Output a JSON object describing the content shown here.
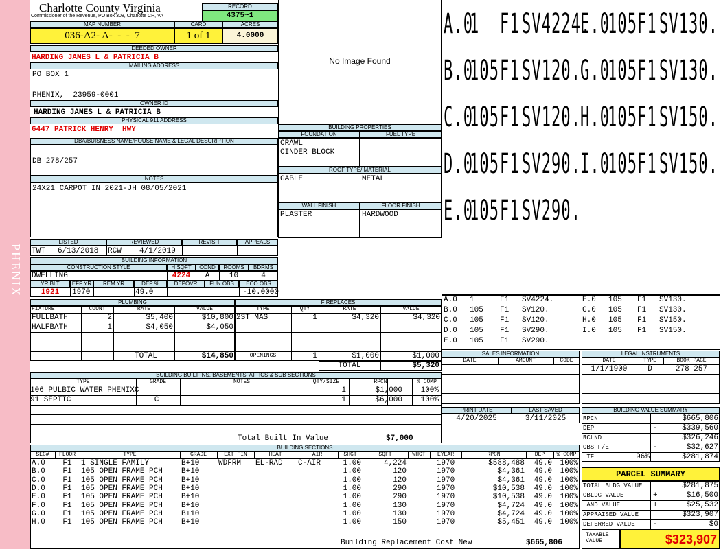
{
  "sidebar": {
    "label": "PHENIX"
  },
  "header": {
    "county": "Charlotte County Virginia",
    "subtitle": "Commissioner of the Revenue, PO Box 308, Charlotte CH, VA",
    "record_label": "RECORD",
    "record": "4375~1",
    "map_label": "MAP NUMBER",
    "map": "036-A2- A-  -  -  7",
    "card_label": "CARD",
    "card": "1 of 1",
    "acres_label": "ACRES",
    "acres": "4.0000"
  },
  "owner": {
    "deeded_label": "DEEDED OWNER",
    "deeded": "HARDING JAMES L & PATRICIA B",
    "mailing_label": "MAILING ADDRESS",
    "mail1": "PO BOX 1",
    "mail2": "PHENIX,  23959-0001",
    "ownerid_label": "OWNER ID",
    "ownerid": "HARDING JAMES L & PATRICIA B",
    "phys_label": "PHYSICAL 911 ADDRESS",
    "phys": "6447 PATRICK HENRY  HWY",
    "dba_label": "DBA/BUISNESS NAME/HOUSE NAME & LEGAL DESCRIPTION",
    "dba": "DB 278/257",
    "notes_label": "NOTES",
    "notes": "24X21 CARPOT IN 2021-JH 08/05/2021"
  },
  "image": {
    "text": "No Image Found"
  },
  "props": {
    "title": "BUILDING PROPERTIES",
    "foundation_label": "FOUNDATION",
    "fuel_label": "FUEL TYPE",
    "found1": "CRAWL",
    "found2": "CINDER BLOCK",
    "roof_label": "ROOF TYPE/ MATERIAL",
    "roof1": "GABLE",
    "roof2": "METAL",
    "wall_label": "WALL FINISH",
    "floor_label": "FLOOR FINISH",
    "wall": "PLASTER",
    "floor": "HARDWOOD"
  },
  "sketch": {
    "lines": [
      [
        "A.0",
        "1",
        "F1",
        "SV4224.",
        "E.0",
        "105",
        "F1",
        "SV130."
      ],
      [
        "B.0",
        "105",
        "F1",
        "SV120.",
        "G.0",
        "105",
        "F1",
        "SV130."
      ],
      [
        "C.0",
        "105",
        "F1",
        "SV120.",
        "H.0",
        "105",
        "F1",
        "SV150."
      ],
      [
        "D.0",
        "105",
        "F1",
        "SV290.",
        "I.0",
        "105",
        "F1",
        "SV150."
      ],
      [
        "E.0",
        "105",
        "F1",
        "SV290.",
        "",
        "",
        "",
        ""
      ]
    ]
  },
  "listed": {
    "listed_label": "LISTED",
    "reviewed_label": "REVIEWED",
    "revisit_label": "REVISIT",
    "appeals_label": "APPEALS",
    "listed_by": "TWT",
    "listed_date": "6/13/2018",
    "reviewed_by": "RCW",
    "reviewed_date": "4/1/2019"
  },
  "info": {
    "title": "BUILDING INFORMATION",
    "cs_label": "CONSTRUCTION STYLE",
    "hsqft_label": "H SQFT",
    "cond_label": "COND",
    "rooms_label": "ROOMS",
    "bdrms_label": "BDRMS",
    "cs": "DWELLING",
    "hsqft": "4224",
    "cond": "A",
    "rooms": "10",
    "bdrms": "4",
    "yrblt_label": "YR BLT",
    "effyr_label": "EFF YR",
    "remyr_label": "REM YR",
    "dep_label": "DEP %",
    "depovr_label": "DEPOVR",
    "funobs_label": "FUN OBS",
    "ecoobs_label": "ECO OBS",
    "yrblt": "1921",
    "effyr": "1970",
    "dep": "49.0",
    "ecoobs": "-10.0000"
  },
  "plumbing": {
    "title": "PLUMBING",
    "headers": [
      "FIXTURE",
      "COUNT",
      "RATE",
      "VALUE"
    ],
    "rows": [
      [
        "FULLBATH",
        "2",
        "$5,400",
        "$10,800"
      ],
      [
        "HALFBATH",
        "1",
        "$4,050",
        "$4,050"
      ]
    ],
    "total_label": "TOTAL",
    "total": "$14,850"
  },
  "fireplaces": {
    "title": "FIREPLACES",
    "headers": [
      "TYPE",
      "QTY",
      "RATE",
      "VALUE"
    ],
    "rows": [
      [
        "2ST MAS",
        "1",
        "$4,320",
        "$4,320"
      ]
    ],
    "openings_label": "OPENINGS",
    "openings_qty": "1",
    "openings_rate": "$1,000",
    "openings_value": "$1,000",
    "total_label": "TOTAL",
    "total": "$5,320"
  },
  "builtins": {
    "title": "BUILDING BUILT INS, BASEMENTS, ATTICS & SUB SECTIONS",
    "headers": [
      "TYPE",
      "GRADE",
      "NOTES",
      "QTY/SIZE",
      "RPCN",
      "% COMP"
    ],
    "rows": [
      [
        "106 PULBIC WATER PHENIXC",
        "",
        "",
        "1",
        "$1,000",
        "100%"
      ],
      [
        "91 SEPTIC",
        "C",
        "",
        "1",
        "$6,000",
        "100%"
      ]
    ],
    "total_label": "Total Built In Value",
    "total": "$7,000"
  },
  "sections": {
    "title": "BUILDING SECTIONS",
    "headers": [
      "SEC#",
      "FLOOR",
      "TYPE",
      "GRADE",
      "EXT FIN",
      "HEAT",
      "AIR",
      "SHGT",
      "SQFT",
      "WHGT",
      "EYEAR",
      "RPCN",
      "DEP",
      "% COMP"
    ],
    "rows": [
      [
        "A.0",
        "F1",
        "1 SINGLE FAMILY",
        "B+10",
        "WDFRM",
        "EL-RAD",
        "C-AIR",
        "1.00",
        "4,224",
        "",
        "1970",
        "$588,488",
        "49.0",
        "100%"
      ],
      [
        "B.0",
        "F1",
        "105 OPEN FRAME PCH",
        "B+10",
        "",
        "",
        "",
        "1.00",
        "120",
        "",
        "1970",
        "$4,361",
        "49.0",
        "100%"
      ],
      [
        "C.0",
        "F1",
        "105 OPEN FRAME PCH",
        "B+10",
        "",
        "",
        "",
        "1.00",
        "120",
        "",
        "1970",
        "$4,361",
        "49.0",
        "100%"
      ],
      [
        "D.0",
        "F1",
        "105 OPEN FRAME PCH",
        "B+10",
        "",
        "",
        "",
        "1.00",
        "290",
        "",
        "1970",
        "$10,538",
        "49.0",
        "100%"
      ],
      [
        "E.0",
        "F1",
        "105 OPEN FRAME PCH",
        "B+10",
        "",
        "",
        "",
        "1.00",
        "290",
        "",
        "1970",
        "$10,538",
        "49.0",
        "100%"
      ],
      [
        "F.0",
        "F1",
        "105 OPEN FRAME PCH",
        "B+10",
        "",
        "",
        "",
        "1.00",
        "130",
        "",
        "1970",
        "$4,724",
        "49.0",
        "100%"
      ],
      [
        "G.0",
        "F1",
        "105 OPEN FRAME PCH",
        "B+10",
        "",
        "",
        "",
        "1.00",
        "130",
        "",
        "1970",
        "$4,724",
        "49.0",
        "100%"
      ],
      [
        "H.0",
        "F1",
        "105 OPEN FRAME PCH",
        "B+10",
        "",
        "",
        "",
        "1.00",
        "150",
        "",
        "1970",
        "$5,451",
        "49.0",
        "100%"
      ]
    ],
    "total_label": "Building Replacement Cost New",
    "total": "$665,806"
  },
  "sales": {
    "title": "SALES INFORMATION",
    "headers": [
      "DATE",
      "AMOUNT",
      "CODE"
    ]
  },
  "legal": {
    "title": "LEGAL INSTRUMENTS",
    "headers": [
      "DATE",
      "TYPE",
      "BOOK PAGE"
    ],
    "row": [
      "1/1/1900",
      "D",
      "278 257"
    ]
  },
  "print": {
    "print_label": "PRINT DATE",
    "saved_label": "LAST SAVED",
    "print": "4/20/2025",
    "saved": "3/11/2025"
  },
  "bvs": {
    "title": "BUILDING VALUE SUMMARY",
    "rows": [
      [
        "RPCN",
        "",
        "$665,806"
      ],
      [
        "DEP",
        "-",
        "$339,560"
      ],
      [
        "RCLND",
        "",
        "$326,246"
      ],
      [
        "OBS F/E",
        "-",
        "$32,627"
      ],
      [
        "LTF",
        "96%",
        "$281,874"
      ]
    ]
  },
  "parcel": {
    "title": "PARCEL SUMMARY",
    "rows": [
      [
        "TOTAL BLDG VALUE",
        "",
        "$281,875"
      ],
      [
        "OBLDG VALUE",
        "+",
        "$16,500"
      ],
      [
        "LAND VALUE",
        "+",
        "$25,532"
      ],
      [
        "APPRAISED VALUE",
        "",
        "$323,907"
      ],
      [
        "DEFERRED VALUE",
        "-",
        "$0"
      ]
    ],
    "taxable_label1": "TAXABLE",
    "taxable_label2": "VALUE",
    "taxable": "$323,907"
  }
}
